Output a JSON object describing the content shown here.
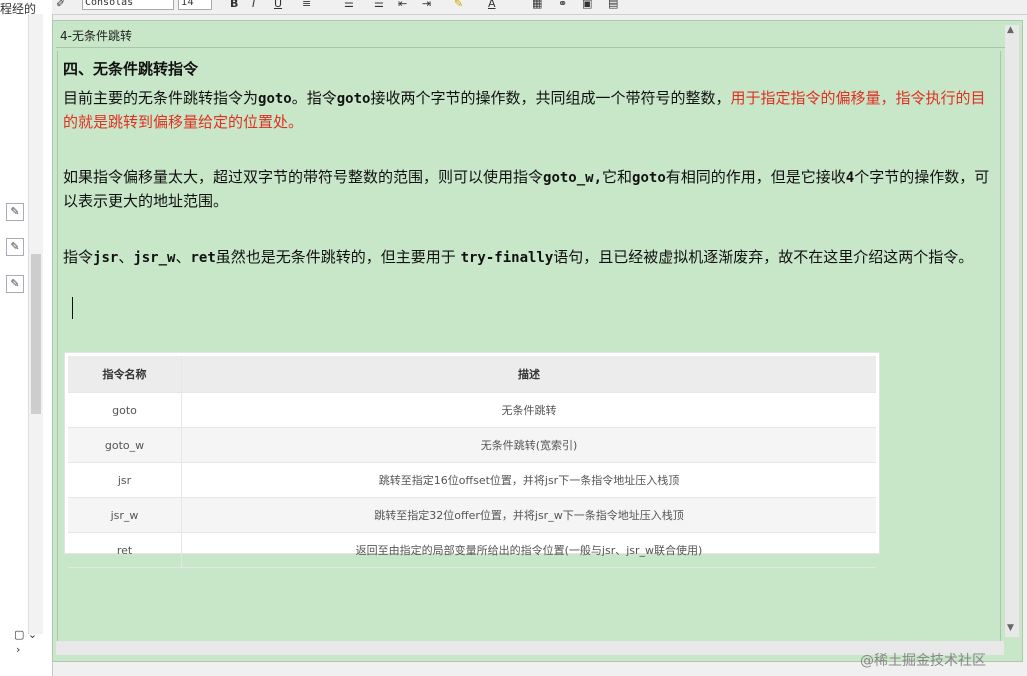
{
  "left_panel": {
    "top_text": "程经的",
    "bottom_text": "▢ ⌄",
    "bottom_arrow": "›"
  },
  "toolbar": {
    "font_name": "Consolas",
    "font_size": "14",
    "bold": "B",
    "italic": "I",
    "underline": "U",
    "font_color_glyph": "A"
  },
  "document": {
    "tab_title": "4-无条件跳转",
    "heading": "四、无条件跳转指令",
    "para1_prefix": "目前主要的无条件跳转指令为",
    "para1_goto": "goto",
    "para1_mid": "。指令",
    "para1_goto2": "goto",
    "para1_mid2": "接收两个字节的操作数，共同组成一个带符号的整数，",
    "para1_red": "用于指定指令的偏移量，指令执行的目的就是跳转到偏移量给定的位置处。",
    "para2_prefix": "如果指令偏移量太大，超过双字节的带符号整数的范围，则可以使用指令",
    "para2_gotow": "goto_w,",
    "para2_mid": "它和",
    "para2_goto": "goto",
    "para2_mid2": "有相同的作用，但是它接收",
    "para2_four": "4",
    "para2_end": "个字节的操作数，可以表示更大的地址范围。",
    "para3_prefix": "指令",
    "para3_jsr": "jsr",
    "para3_sep1": "、",
    "para3_jsrw": "jsr_w",
    "para3_sep2": "、",
    "para3_ret": "ret",
    "para3_mid": "虽然也是无条件跳转的，但主要用于 ",
    "para3_tf": "try-finally",
    "para3_end": "语句，且已经被虚拟机逐渐废弃，故不在这里介绍这两个指令。"
  },
  "table": {
    "headers": [
      "指令名称",
      "描述"
    ],
    "rows": [
      [
        "goto",
        "无条件跳转"
      ],
      [
        "goto_w",
        "无条件跳转(宽索引)"
      ],
      [
        "jsr",
        "跳转至指定16位offset位置，并将jsr下一条指令地址压入栈顶"
      ],
      [
        "jsr_w",
        "跳转至指定32位offer位置，并将jsr_w下一条指令地址压入栈顶"
      ],
      [
        "ret",
        "返回至由指定的局部变量所给出的指令位置(一般与jsr、jsr_w联合使用)"
      ]
    ]
  },
  "watermark": "@稀土掘金技术社区",
  "colors": {
    "editor_bg": "#c8e6c8",
    "highlight_red": "#e03020"
  }
}
